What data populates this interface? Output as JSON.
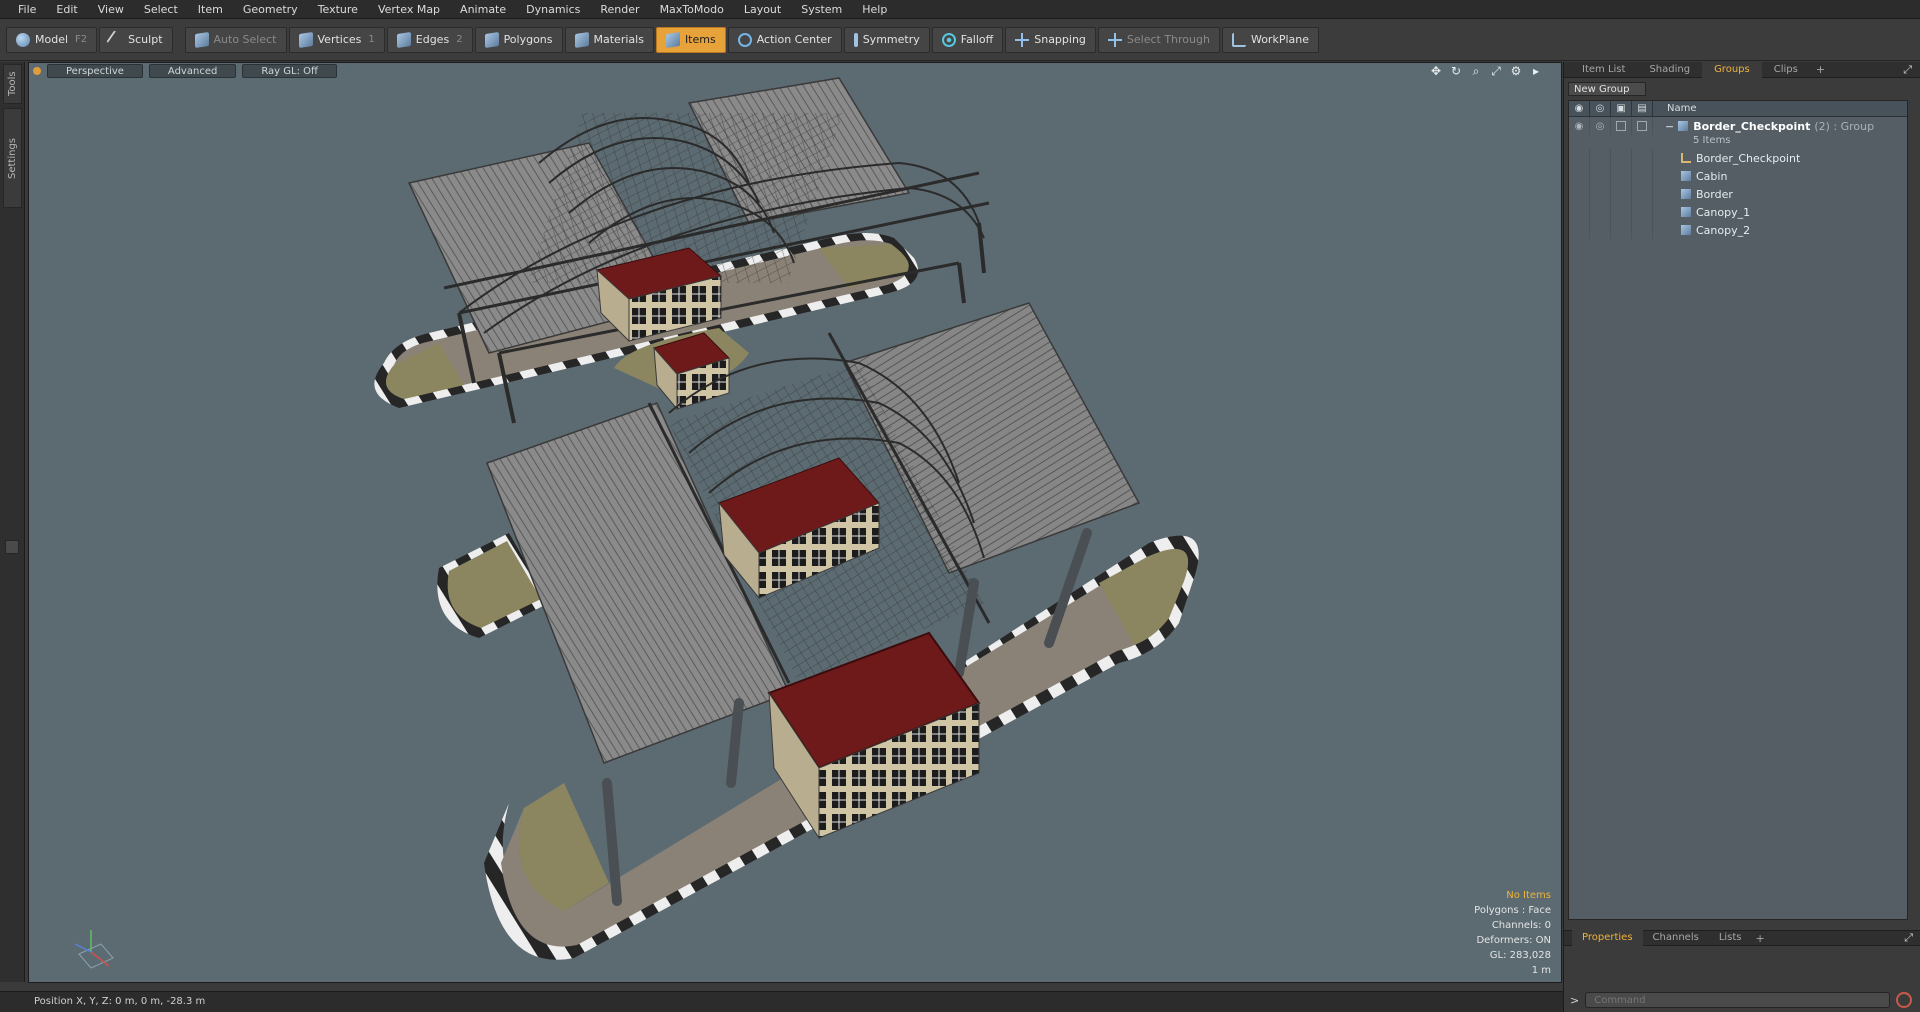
{
  "menu": [
    "File",
    "Edit",
    "View",
    "Select",
    "Item",
    "Geometry",
    "Texture",
    "Vertex Map",
    "Animate",
    "Dynamics",
    "Render",
    "MaxToModo",
    "Layout",
    "System",
    "Help"
  ],
  "toolbar": {
    "model": {
      "label": "Model",
      "key": "F2"
    },
    "sculpt": {
      "label": "Sculpt"
    },
    "auto_select": {
      "label": "Auto Select"
    },
    "vertices": {
      "label": "Vertices",
      "key": "1"
    },
    "edges": {
      "label": "Edges",
      "key": "2"
    },
    "polygons": {
      "label": "Polygons"
    },
    "materials": {
      "label": "Materials"
    },
    "items": {
      "label": "Items"
    },
    "action_center": {
      "label": "Action Center"
    },
    "symmetry": {
      "label": "Symmetry"
    },
    "falloff": {
      "label": "Falloff"
    },
    "snapping": {
      "label": "Snapping"
    },
    "select_through": {
      "label": "Select Through"
    },
    "workplane": {
      "label": "WorkPlane"
    }
  },
  "left_strip": {
    "tools": "Tools",
    "settings": "Settings"
  },
  "viewport": {
    "tabs": [
      "Perspective",
      "Advanced",
      "Ray GL: Off"
    ],
    "stats": {
      "selection": "No Items",
      "polygons": "Polygons : Face",
      "channels": "Channels: 0",
      "deformers": "Deformers: ON",
      "gl": "GL: 283,028",
      "scale": "1 m"
    }
  },
  "right_panel": {
    "tabs": [
      "Item List",
      "Shading",
      "Groups",
      "Clips"
    ],
    "active_tab": "Groups",
    "new_group": "New Group",
    "column_name": "Name",
    "group": {
      "name": "Border_Checkpoint",
      "suffix": "(2) : Group",
      "count": "5 Items"
    },
    "items": [
      "Border_Checkpoint",
      "Cabin",
      "Border",
      "Canopy_1",
      "Canopy_2"
    ],
    "bottom_tabs": [
      "Properties",
      "Channels",
      "Lists"
    ],
    "command_placeholder": "Command"
  },
  "statusbar": {
    "position": "Position X, Y, Z:  0 m, 0 m, -28.3 m"
  },
  "colors": {
    "accent": "#e8a23a",
    "viewport_bg": "#5c6b72",
    "roof_red": "#6e1a1a"
  }
}
